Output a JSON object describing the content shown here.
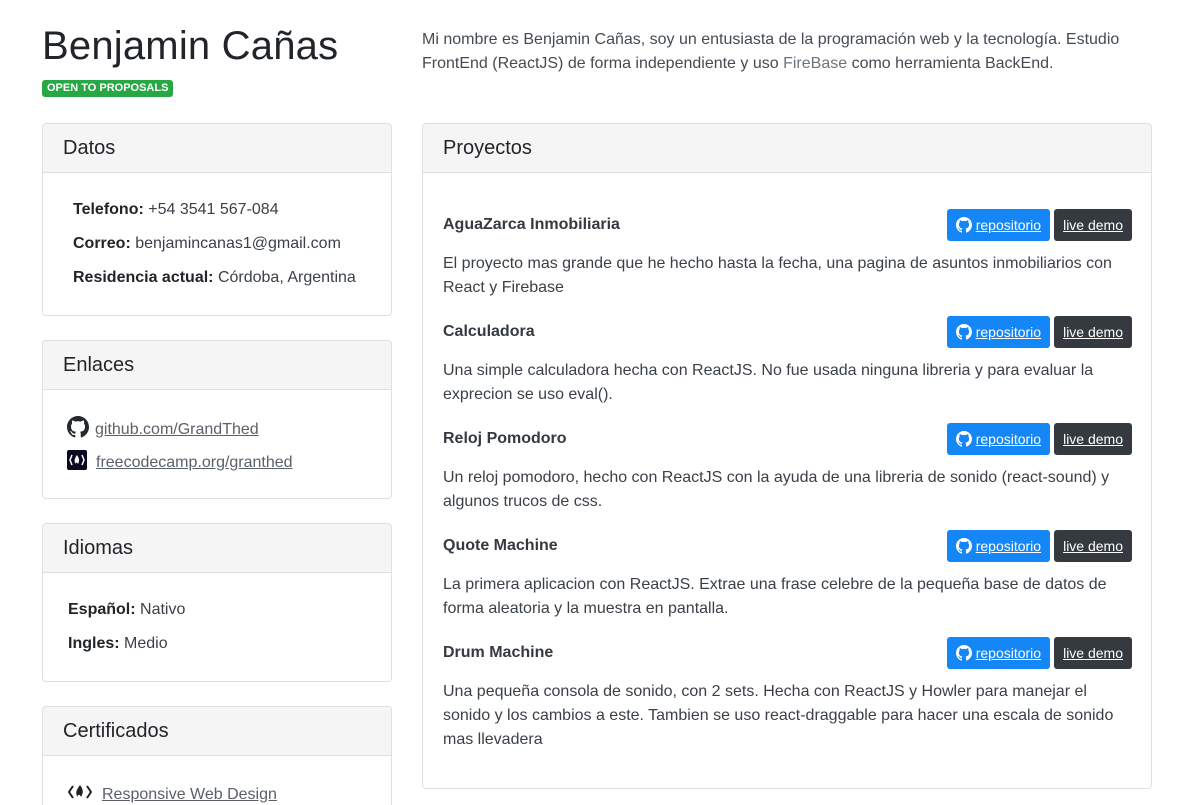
{
  "header": {
    "name": "Benjamin Cañas",
    "badge": "OPEN TO PROPOSALS",
    "intro_before": "Mi nombre es Benjamin Cañas, soy un entusiasta de la programación web y la tecnología. Estudio FrontEnd (ReactJS) de forma independiente y uso ",
    "intro_link": "FireBase",
    "intro_after": " como herramienta BackEnd."
  },
  "datos": {
    "title": "Datos",
    "telefono_label": "Telefono:",
    "telefono_value": " +54 3541 567-084",
    "correo_label": "Correo:",
    "correo_value": " benjamincanas1@gmail.com",
    "residencia_label": "Residencia actual:",
    "residencia_value": " Córdoba, Argentina"
  },
  "enlaces": {
    "title": "Enlaces",
    "items": [
      {
        "label": "github.com/GrandThed",
        "icon": "github-icon"
      },
      {
        "label": "freecodecamp.org/granthed",
        "icon": "freecodecamp-icon"
      }
    ]
  },
  "idiomas": {
    "title": "Idiomas",
    "espanol_label": "Español:",
    "espanol_value": " Nativo",
    "ingles_label": "Ingles:",
    "ingles_value": " Medio"
  },
  "certificados": {
    "title": "Certificados",
    "items": [
      {
        "label": "Responsive Web Design",
        "icon": "freecodecamp-icon"
      }
    ]
  },
  "proyectos": {
    "title": "Proyectos",
    "repo_label": "repositorio",
    "demo_label": "live demo",
    "items": [
      {
        "title": "AguaZarca Inmobiliaria",
        "desc": "El proyecto mas grande que he hecho hasta la fecha, una pagina de asuntos inmobiliarios con React y Firebase"
      },
      {
        "title": "Calculadora",
        "desc": "Una simple calculadora hecha con ReactJS. No fue usada ninguna libreria y para evaluar la exprecion se uso eval()."
      },
      {
        "title": "Reloj Pomodoro",
        "desc": "Un reloj pomodoro, hecho con ReactJS con la ayuda de una libreria de sonido (react-sound) y algunos trucos de css."
      },
      {
        "title": "Quote Machine",
        "desc": "La primera aplicacion con ReactJS. Extrae una frase celebre de la pequeña base de datos de forma aleatoria y la muestra en pantalla."
      },
      {
        "title": "Drum Machine",
        "desc": "Una pequeña consola de sonido, con 2 sets. Hecha con ReactJS y Howler para manejar el sonido y los cambios a este. Tambien se uso react-draggable para hacer una escala de sonido mas llevadera"
      }
    ]
  },
  "colors": {
    "badge": "#28a745",
    "repo_button": "#1586f6",
    "demo_button": "#343a40",
    "card_header": "#f5f5f5"
  }
}
